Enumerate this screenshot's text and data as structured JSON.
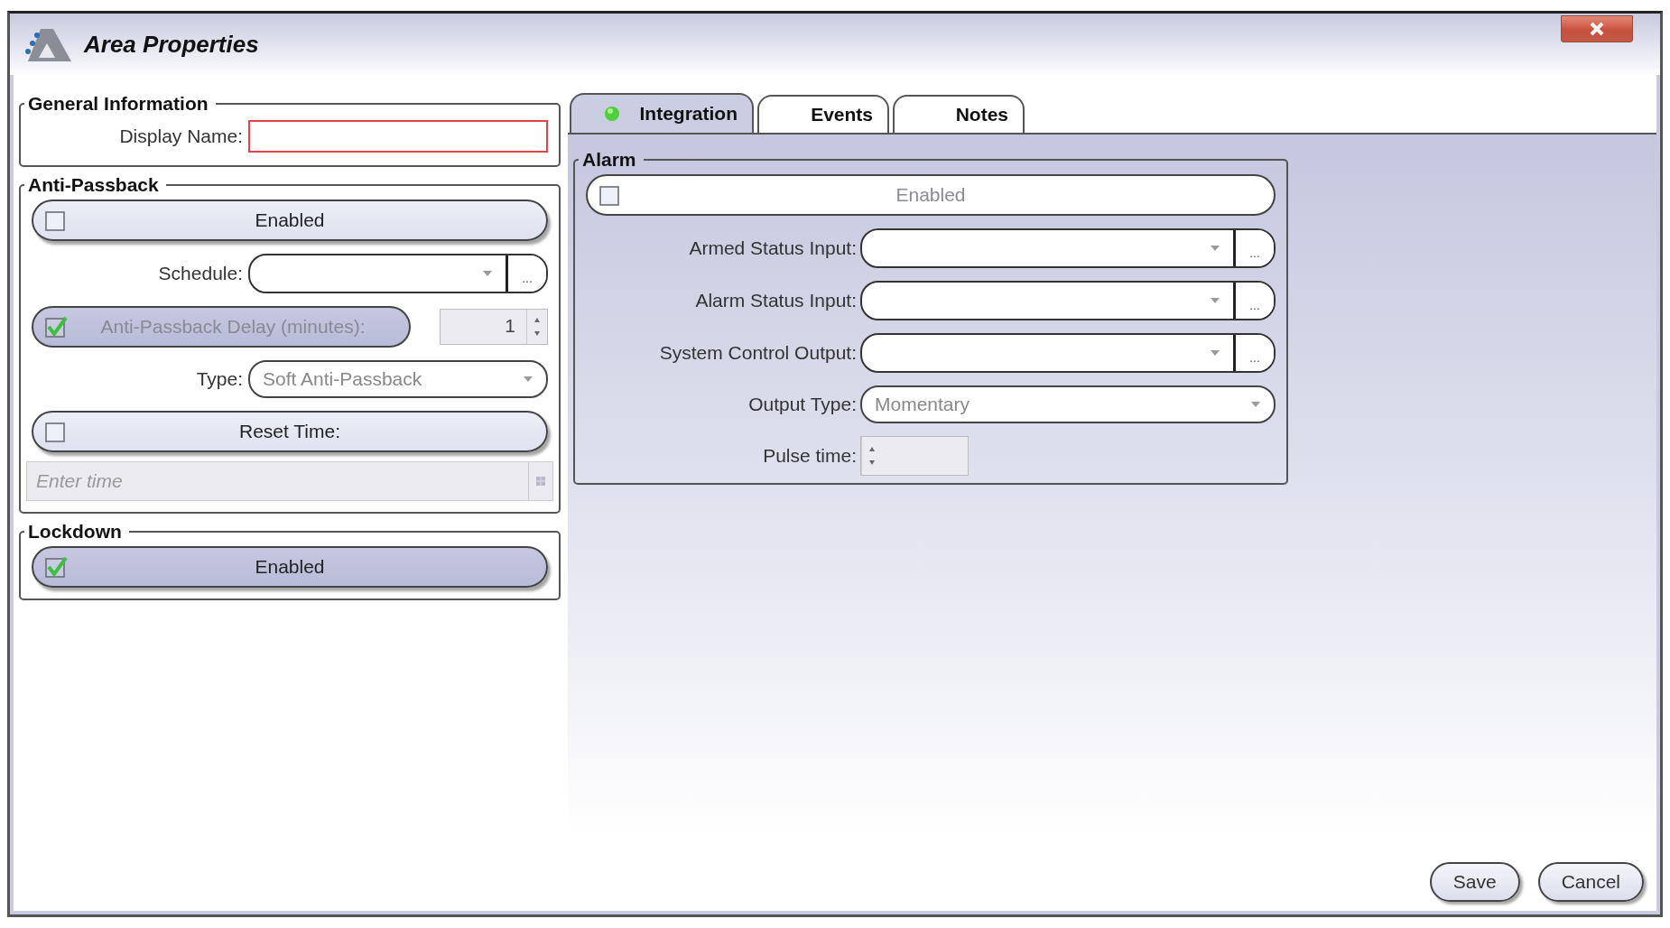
{
  "window": {
    "title": "Area Properties"
  },
  "general_information": {
    "title": "General Information",
    "display_name": {
      "label": "Display Name:",
      "invalid": true
    }
  },
  "anti_passback": {
    "title": "Anti-Passback",
    "rows": [
      {
        "kind": "toggle",
        "label": "Enabled",
        "checked": false,
        "disabled": false
      },
      {
        "kind": "combo",
        "label": "Schedule:",
        "browse": "..."
      },
      {
        "kind": "toggle_spin",
        "label": "Anti-Passback Delay (minutes):",
        "checked": true,
        "disabled": true,
        "value": "1"
      },
      {
        "kind": "select",
        "label": "Type:",
        "value": "Soft Anti-Passback",
        "disabled": true
      },
      {
        "kind": "toggle",
        "label": "Reset Time:",
        "checked": false,
        "disabled": false
      },
      {
        "kind": "time",
        "placeholder": "Enter time"
      }
    ]
  },
  "lockdown": {
    "title": "Lockdown",
    "rows": [
      {
        "kind": "toggle",
        "label": "Enabled",
        "checked": true,
        "disabled": false
      }
    ]
  },
  "tabs": [
    {
      "label": "Integration",
      "selected": true,
      "status_dot": true
    },
    {
      "label": "Events",
      "selected": false,
      "status_dot": false
    },
    {
      "label": "Notes",
      "selected": false,
      "status_dot": false
    }
  ],
  "alarm": {
    "title": "Alarm",
    "rows": [
      {
        "kind": "toggle",
        "label": "Enabled",
        "checked": false,
        "disabled": true
      },
      {
        "kind": "combo",
        "label": "Armed Status Input:",
        "browse": "..."
      },
      {
        "kind": "combo",
        "label": "Alarm Status Input:",
        "browse": "..."
      },
      {
        "kind": "combo",
        "label": "System Control Output:",
        "browse": "..."
      },
      {
        "kind": "select",
        "label": "Output Type:",
        "value": "Momentary",
        "disabled": true
      },
      {
        "kind": "spin",
        "label": "Pulse time:"
      }
    ]
  },
  "buttons": [
    {
      "label": "Save"
    },
    {
      "label": "Cancel"
    }
  ]
}
